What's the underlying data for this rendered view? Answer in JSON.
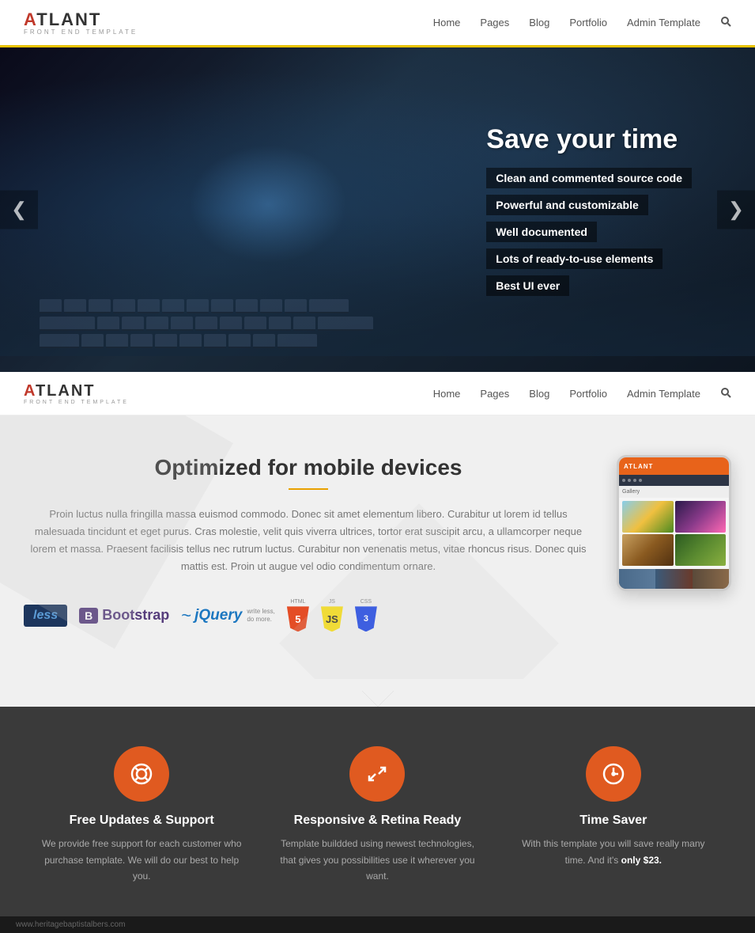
{
  "site": {
    "logo_main": "ATLANT",
    "logo_letter": "A",
    "logo_sub": "FRONT END TEMPLATE"
  },
  "navbar": {
    "links": [
      {
        "label": "Home",
        "href": "#"
      },
      {
        "label": "Pages",
        "href": "#"
      },
      {
        "label": "Blog",
        "href": "#"
      },
      {
        "label": "Portfolio",
        "href": "#"
      },
      {
        "label": "Admin Template",
        "href": "#"
      }
    ]
  },
  "hero": {
    "title": "Save your time",
    "features": [
      "Clean and commented source code",
      "Powerful and customizable",
      "Well documented",
      "Lots of ready-to-use elements",
      "Best UI ever"
    ],
    "arrow_left": "❮",
    "arrow_right": "❯"
  },
  "mobile_section": {
    "title": "Optimized for mobile devices",
    "description": "Proin luctus nulla fringilla massa euismod commodo. Donec sit amet elementum libero. Curabitur ut lorem id tellus malesuada tincidunt et eget purus. Cras molestie, velit quis viverra ultrices, tortor erat suscipit arcu, a ullamcorper neque lorem et massa. Praesent facilisis tellus nec rutrum luctus. Curabitur non venenatis metus, vitae rhoncus risus. Donec quis mattis est. Proin ut augue vel odio condimentum ornare.",
    "tech_badges": [
      {
        "label": "less",
        "type": "less"
      },
      {
        "label": "Bootstrap",
        "type": "bootstrap"
      },
      {
        "label": "jQuery",
        "type": "jquery"
      },
      {
        "label": "HTML5",
        "type": "html5"
      },
      {
        "label": "JS",
        "type": "js"
      },
      {
        "label": "CSS3",
        "type": "css3"
      }
    ]
  },
  "features": [
    {
      "icon": "⊕",
      "title": "Free Updates & Support",
      "desc": "We provide free support for each customer who purchase template. We will do our best to help you."
    },
    {
      "icon": "↗",
      "title": "Responsive & Retina Ready",
      "desc": "Template buildded using newest technologies, that gives you possibilities use it wherever you want."
    },
    {
      "icon": "⏱",
      "title": "Time Saver",
      "desc": "With this template you will save really many time. And it's only $23."
    }
  ],
  "bottom_bar": {
    "text": "www.heritagebaptistalbers.com"
  },
  "colors": {
    "accent": "#e05a20",
    "logo_red": "#c0392b",
    "nav_border": "#e8c200",
    "dark_bg": "#3a3a3a"
  }
}
